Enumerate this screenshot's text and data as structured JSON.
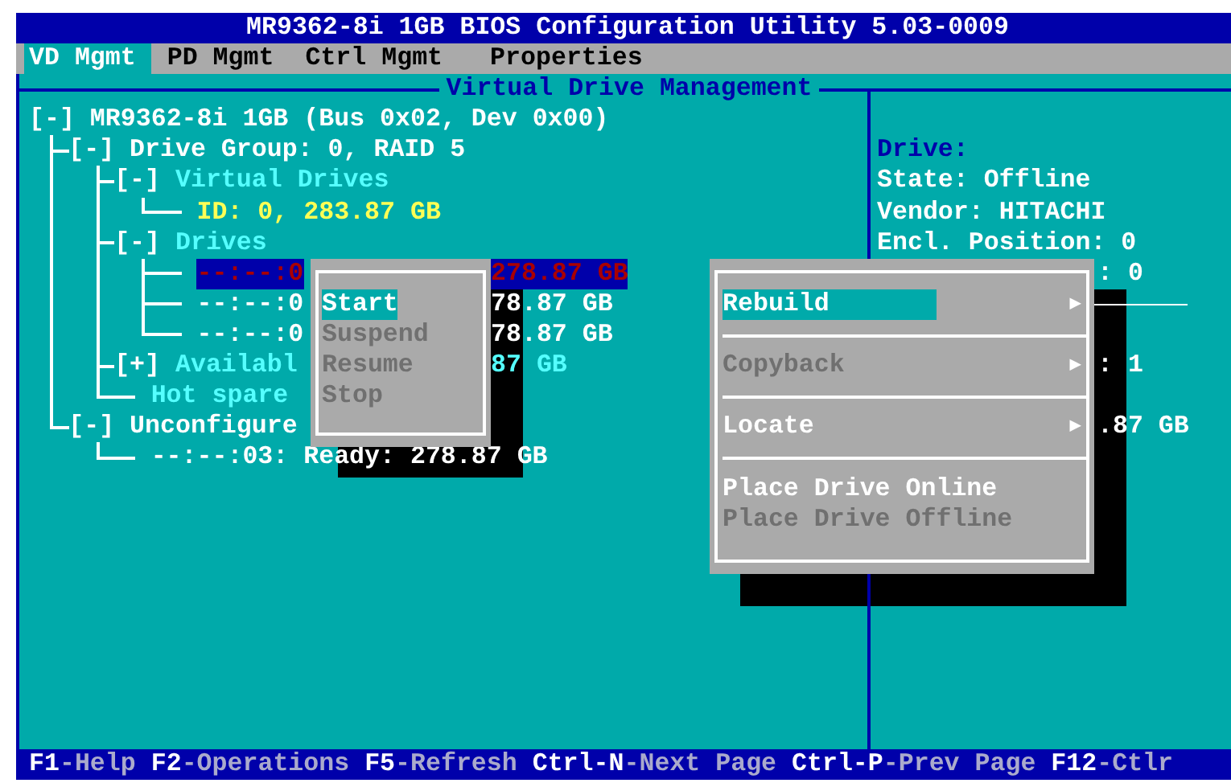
{
  "title": "MR9362-8i 1GB BIOS Configuration Utility 5.03-0009",
  "tabs": [
    {
      "label": "VD Mgmt",
      "selected": true
    },
    {
      "label": "PD Mgmt",
      "selected": false
    },
    {
      "label": "Ctrl Mgmt",
      "selected": false
    },
    {
      "label": "Properties",
      "selected": false
    }
  ],
  "panel": {
    "heading": "Virtual Drive Management"
  },
  "tree": [
    {
      "kind": "node",
      "toggle": "[-]",
      "label": "MR9362-8i 1GB (Bus 0x02, Dev 0x00)",
      "selected": false,
      "children": [
        {
          "kind": "node",
          "toggle": "[-]",
          "label": "Drive Group: 0, RAID 5",
          "selected": false,
          "children": [
            {
              "kind": "folder",
              "toggle": "[-]",
              "label": "Virtual Drives",
              "selected": false,
              "children": [
                {
                  "kind": "volume",
                  "label": "ID: 0, 283.87 GB",
                  "selected": false
                }
              ]
            },
            {
              "kind": "folder",
              "toggle": "[-]",
              "label": "Drives",
              "selected": false,
              "children": [
                {
                  "kind": "node",
                  "label": "--:--:0",
                  "tail": "278.87 GB",
                  "selected": true
                },
                {
                  "kind": "node",
                  "label": "--:--:0",
                  "tail": "78.87 GB",
                  "selected": false
                },
                {
                  "kind": "node",
                  "label": "--:--:0",
                  "tail": "78.87 GB",
                  "selected": false
                }
              ]
            },
            {
              "kind": "folder",
              "toggle": "[+]",
              "label": "Availabl",
              "tail": "87 GB",
              "selected": false
            },
            {
              "kind": "folder",
              "label": "Hot spare",
              "selected": false
            }
          ]
        },
        {
          "kind": "node",
          "toggle": "[-]",
          "label": "Unconfigure",
          "selected": false,
          "children": [
            {
              "kind": "node",
              "label": "--:--:03: Ready: 278.87 GB",
              "selected": false
            }
          ]
        }
      ]
    }
  ],
  "details": {
    "heading": "Drive:",
    "lines": [
      "State: Offline",
      "Vendor: HITACHI",
      "Encl. Position: 0"
    ],
    "partial": [
      ": 0",
      ": 1",
      ".87 GB"
    ]
  },
  "operations_menu": {
    "items": [
      {
        "label": "Start",
        "selected": true,
        "disabled": false
      },
      {
        "label": "Suspend",
        "selected": false,
        "disabled": true
      },
      {
        "label": "Resume",
        "selected": false,
        "disabled": true
      },
      {
        "label": "Stop",
        "selected": false,
        "disabled": true
      }
    ]
  },
  "drive_menu": {
    "items": [
      {
        "kind": "item",
        "label": "Rebuild",
        "selected": true,
        "disabled": false,
        "arrow": "▶"
      },
      {
        "kind": "separator"
      },
      {
        "kind": "item",
        "label": "Copyback",
        "selected": false,
        "disabled": true,
        "arrow": "▶"
      },
      {
        "kind": "separator"
      },
      {
        "kind": "item",
        "label": "Locate",
        "selected": false,
        "disabled": false,
        "arrow": "▶"
      },
      {
        "kind": "separator"
      },
      {
        "kind": "item",
        "label": "Place Drive Online",
        "selected": false,
        "disabled": false
      },
      {
        "kind": "item",
        "label": "Place Drive Offline",
        "selected": false,
        "disabled": true
      }
    ]
  },
  "status_bar": [
    {
      "key": "F1",
      "action": "-Help"
    },
    {
      "key": "F2",
      "action": "-Operations"
    },
    {
      "key": "F5",
      "action": "-Refresh"
    },
    {
      "key": "Ctrl-N",
      "action": "-Next Page"
    },
    {
      "key": "Ctrl-P",
      "action": "-Prev Page"
    },
    {
      "key": "F12",
      "action": "-Ctlr"
    }
  ]
}
